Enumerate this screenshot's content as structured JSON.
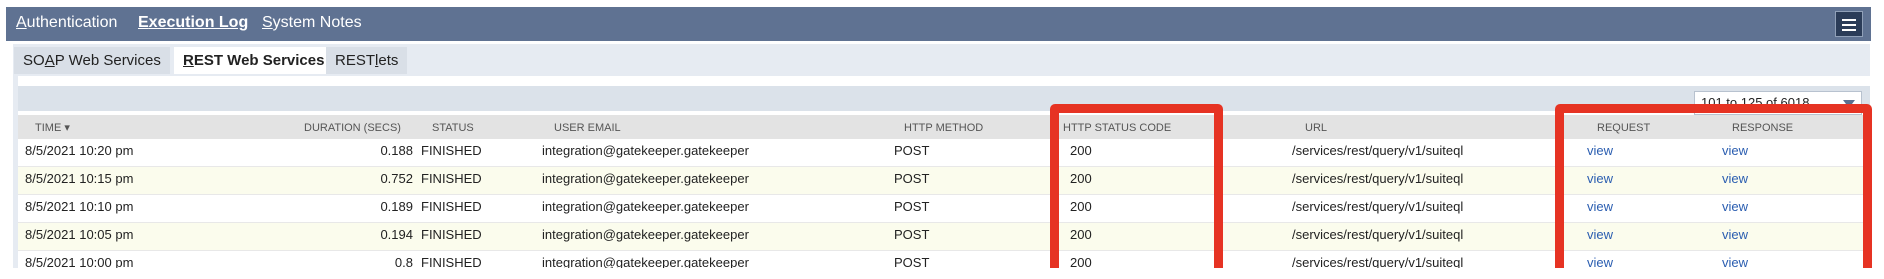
{
  "top_tabs": [
    {
      "acc": "A",
      "rest": "uthentication",
      "active": false
    },
    {
      "acc": "E",
      "rest": "xecution Log",
      "active": true
    },
    {
      "acc": "S",
      "rest": "ystem Notes",
      "active": false
    }
  ],
  "sub_tabs": [
    {
      "pre": "SO",
      "acc": "A",
      "post": "P Web Services",
      "active": false
    },
    {
      "pre": "",
      "acc": "R",
      "post": "EST Web Services",
      "active": true
    },
    {
      "pre": "REST",
      "acc": "l",
      "post": "ets",
      "active": false
    }
  ],
  "pager": {
    "value": "101 to 125 of 6018"
  },
  "columns": {
    "time": "TIME ▾",
    "duration": "DURATION (SECS)",
    "status": "STATUS",
    "user_email": "USER EMAIL",
    "http_method": "HTTP METHOD",
    "http_status_code": "HTTP STATUS CODE",
    "url": "URL",
    "request": "REQUEST",
    "response": "RESPONSE"
  },
  "rows": [
    {
      "time": "8/5/2021 10:20 pm",
      "duration": "0.188",
      "status": "FINISHED",
      "email": "integration@gatekeeper.gatekeeper",
      "method": "POST",
      "code": "200",
      "url": "/services/rest/query/v1/suiteql",
      "request": "view",
      "response": "view"
    },
    {
      "time": "8/5/2021 10:15 pm",
      "duration": "0.752",
      "status": "FINISHED",
      "email": "integration@gatekeeper.gatekeeper",
      "method": "POST",
      "code": "200",
      "url": "/services/rest/query/v1/suiteql",
      "request": "view",
      "response": "view"
    },
    {
      "time": "8/5/2021 10:10 pm",
      "duration": "0.189",
      "status": "FINISHED",
      "email": "integration@gatekeeper.gatekeeper",
      "method": "POST",
      "code": "200",
      "url": "/services/rest/query/v1/suiteql",
      "request": "view",
      "response": "view"
    },
    {
      "time": "8/5/2021 10:05 pm",
      "duration": "0.194",
      "status": "FINISHED",
      "email": "integration@gatekeeper.gatekeeper",
      "method": "POST",
      "code": "200",
      "url": "/services/rest/query/v1/suiteql",
      "request": "view",
      "response": "view"
    },
    {
      "time": "8/5/2021 10:00 pm",
      "duration": "0.8",
      "status": "FINISHED",
      "email": "integration@gatekeeper.gatekeeper",
      "method": "POST",
      "code": "200",
      "url": "/services/rest/query/v1/suiteql",
      "request": "view",
      "response": "view"
    }
  ],
  "colors": {
    "nav": "#5f7292",
    "highlight": "#e63323",
    "link": "#2a5db0"
  }
}
